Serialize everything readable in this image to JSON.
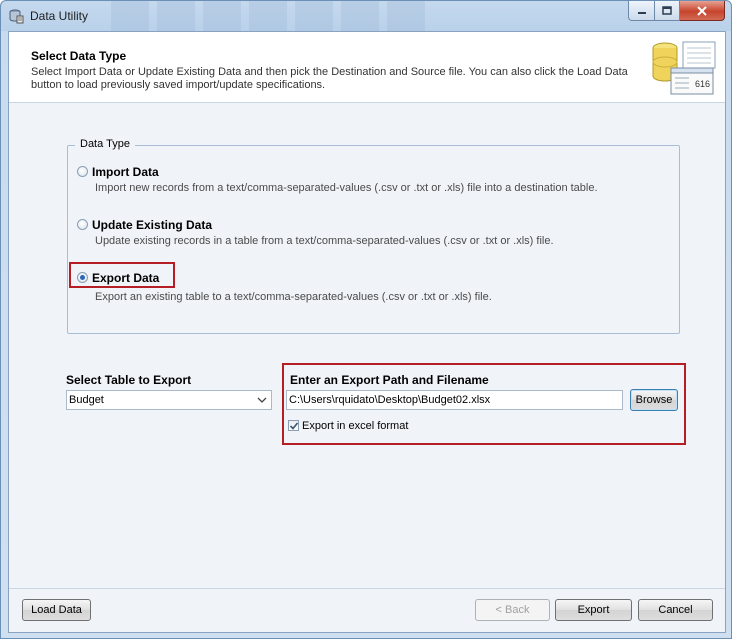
{
  "window": {
    "title": "Data Utility"
  },
  "header": {
    "title": "Select Data Type",
    "description": "Select Import Data or Update Existing Data and then pick the Destination and Source file.  You can also click the Load Data button to load previously saved import/update specifications.",
    "art_number": "616"
  },
  "data_type": {
    "legend": "Data Type",
    "options": [
      {
        "label": "Import Data",
        "description": "Import new records from a text/comma-separated-values (.csv or .txt or .xls) file into a destination table.",
        "selected": false
      },
      {
        "label": "Update Existing Data",
        "description": "Update existing records in a table from a text/comma-separated-values (.csv or .txt or .xls) file.",
        "selected": false
      },
      {
        "label": "Export Data",
        "description": "Export an existing table to a text/comma-separated-values (.csv or .txt or .xls) file.",
        "selected": true
      }
    ]
  },
  "export_table": {
    "label": "Select Table to Export",
    "value": "Budget"
  },
  "export_path": {
    "label": "Enter an Export Path and Filename",
    "value": "C:\\Users\\rquidato\\Desktop\\Budget02.xlsx",
    "browse_label": "Browse",
    "excel_label": "Export in excel format",
    "excel_checked": true
  },
  "footer": {
    "load_label": "Load Data",
    "back_label": "< Back",
    "export_label": "Export",
    "cancel_label": "Cancel"
  },
  "colors": {
    "highlight": "#b51e25",
    "accent": "#2a67b8"
  }
}
